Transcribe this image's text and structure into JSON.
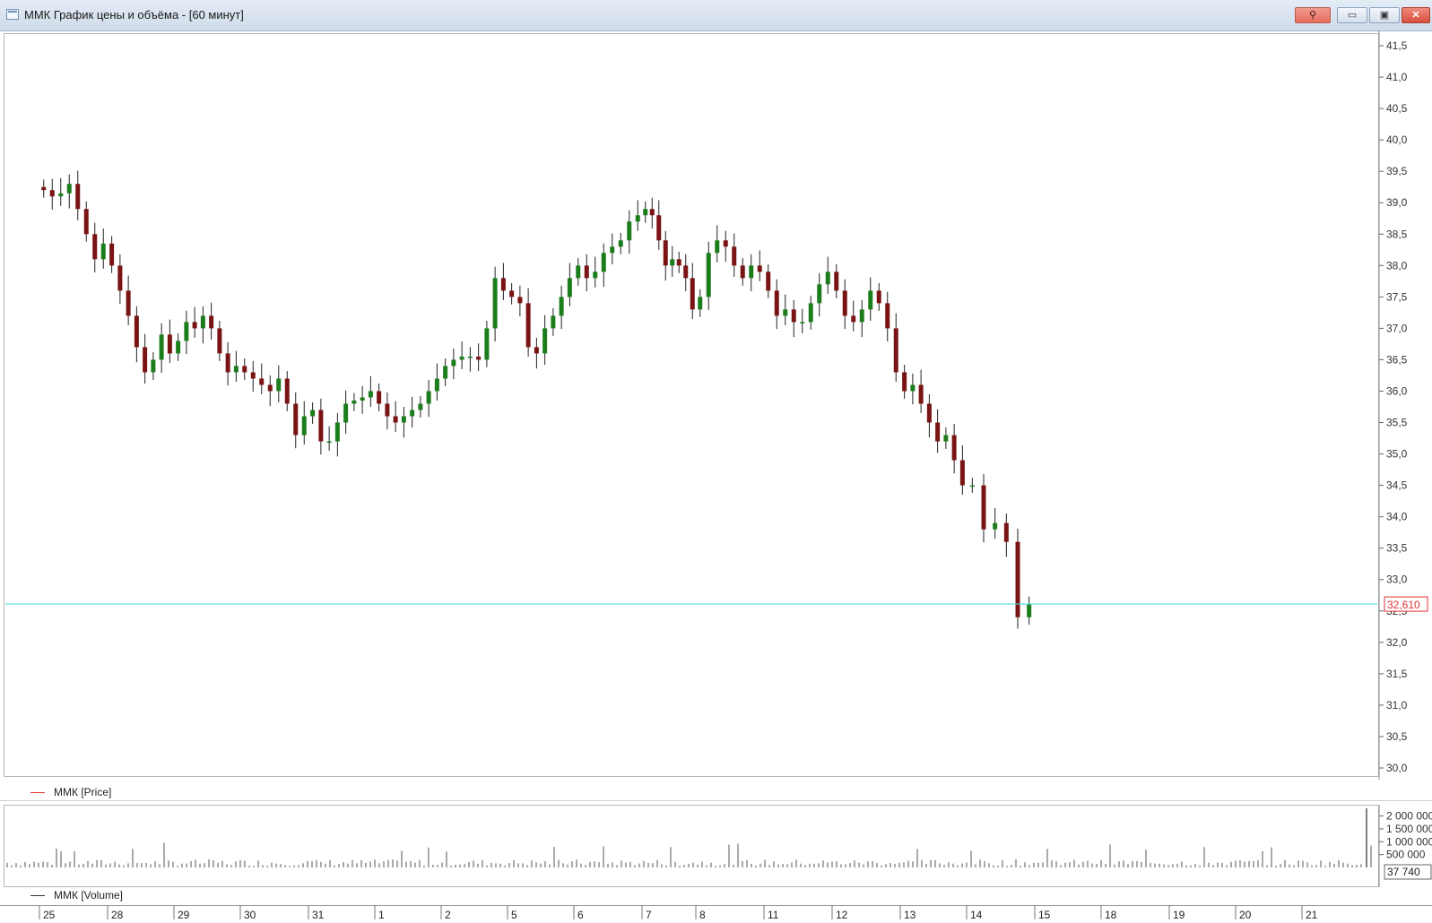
{
  "window": {
    "title": "ММК График цены и объёма - [60 минут]",
    "buttons": [
      {
        "name": "link-button",
        "icon": "link-icon",
        "glyph": "⚲"
      },
      {
        "name": "minimize-button",
        "icon": "minimize-icon",
        "glyph": "▭"
      },
      {
        "name": "maximize-button",
        "icon": "maximize-icon",
        "glyph": "▣"
      },
      {
        "name": "close-button",
        "icon": "close-icon",
        "glyph": "✕"
      }
    ]
  },
  "colors": {
    "bull": "#1b7d1b",
    "bear": "#7a1414",
    "wick": "#222222",
    "level_line": "#49dede",
    "price_label": "#e03030",
    "legend_price": "#e03030",
    "legend_volume": "#333333",
    "volume_bar": "#555555"
  },
  "price_panel": {
    "legend": "ММК [Price]",
    "current_price_label": "32,610"
  },
  "volume_panel": {
    "legend": "ММК [Volume]",
    "current_volume_label": "37 740"
  },
  "chart_data": [
    {
      "type": "candlestick",
      "name": "ММК [Price]",
      "interval": "60 минут",
      "ylim": [
        30.0,
        41.5
      ],
      "y_ticks": [
        "41,5",
        "41,0",
        "40,5",
        "40,0",
        "39,5",
        "39,0",
        "38,5",
        "38,0",
        "37,5",
        "37,0",
        "36,5",
        "36,0",
        "35,5",
        "35,0",
        "34,5",
        "34,0",
        "33,5",
        "33,0",
        "32,5",
        "32,0",
        "31,5",
        "31,0",
        "30,5",
        "30,0"
      ],
      "x_ticks": [
        "25",
        "28",
        "29",
        "30",
        "31",
        "1",
        "2",
        "5",
        "6",
        "7",
        "8",
        "11",
        "12",
        "13",
        "14",
        "15",
        "18",
        "19",
        "20",
        "21"
      ],
      "current_level": 32.61,
      "close_path": [
        [
          "25",
          39.2
        ],
        [
          "25",
          39.1
        ],
        [
          "25",
          39.15
        ],
        [
          "25",
          39.3
        ],
        [
          "25",
          38.9
        ],
        [
          "25",
          38.5
        ],
        [
          "25",
          38.1
        ],
        [
          "25",
          38.35
        ],
        [
          "28",
          38.0
        ],
        [
          "28",
          37.6
        ],
        [
          "28",
          37.2
        ],
        [
          "28",
          36.7
        ],
        [
          "28",
          36.3
        ],
        [
          "28",
          36.5
        ],
        [
          "28",
          36.9
        ],
        [
          "28",
          36.6
        ],
        [
          "29",
          36.8
        ],
        [
          "29",
          37.1
        ],
        [
          "29",
          37.0
        ],
        [
          "29",
          37.2
        ],
        [
          "29",
          37.0
        ],
        [
          "29",
          36.6
        ],
        [
          "29",
          36.3
        ],
        [
          "29",
          36.4
        ],
        [
          "30",
          36.3
        ],
        [
          "30",
          36.2
        ],
        [
          "30",
          36.1
        ],
        [
          "30",
          36.0
        ],
        [
          "30",
          36.2
        ],
        [
          "30",
          35.8
        ],
        [
          "30",
          35.3
        ],
        [
          "30",
          35.6
        ],
        [
          "31",
          35.7
        ],
        [
          "31",
          35.2
        ],
        [
          "31",
          35.2
        ],
        [
          "31",
          35.5
        ],
        [
          "31",
          35.8
        ],
        [
          "31",
          35.85
        ],
        [
          "31",
          35.9
        ],
        [
          "31",
          36.0
        ],
        [
          "1",
          35.8
        ],
        [
          "1",
          35.6
        ],
        [
          "1",
          35.5
        ],
        [
          "1",
          35.6
        ],
        [
          "1",
          35.7
        ],
        [
          "1",
          35.8
        ],
        [
          "1",
          36.0
        ],
        [
          "1",
          36.2
        ],
        [
          "2",
          36.4
        ],
        [
          "2",
          36.5
        ],
        [
          "2",
          36.55
        ],
        [
          "2",
          36.55
        ],
        [
          "2",
          36.5
        ],
        [
          "2",
          37.0
        ],
        [
          "2",
          37.8
        ],
        [
          "2",
          37.6
        ],
        [
          "5",
          37.5
        ],
        [
          "5",
          37.4
        ],
        [
          "5",
          36.7
        ],
        [
          "5",
          36.6
        ],
        [
          "5",
          37.0
        ],
        [
          "5",
          37.2
        ],
        [
          "5",
          37.5
        ],
        [
          "5",
          37.8
        ],
        [
          "6",
          38.0
        ],
        [
          "6",
          37.8
        ],
        [
          "6",
          37.9
        ],
        [
          "6",
          38.2
        ],
        [
          "6",
          38.3
        ],
        [
          "6",
          38.4
        ],
        [
          "6",
          38.7
        ],
        [
          "6",
          38.8
        ],
        [
          "7",
          38.9
        ],
        [
          "7",
          38.8
        ],
        [
          "7",
          38.4
        ],
        [
          "7",
          38.0
        ],
        [
          "7",
          38.1
        ],
        [
          "7",
          38.0
        ],
        [
          "7",
          37.8
        ],
        [
          "7",
          37.3
        ],
        [
          "8",
          37.5
        ],
        [
          "8",
          38.2
        ],
        [
          "8",
          38.4
        ],
        [
          "8",
          38.3
        ],
        [
          "8",
          38.0
        ],
        [
          "8",
          37.8
        ],
        [
          "8",
          38.0
        ],
        [
          "8",
          37.9
        ],
        [
          "11",
          37.6
        ],
        [
          "11",
          37.2
        ],
        [
          "11",
          37.3
        ],
        [
          "11",
          37.1
        ],
        [
          "11",
          37.1
        ],
        [
          "11",
          37.4
        ],
        [
          "11",
          37.7
        ],
        [
          "11",
          37.9
        ],
        [
          "12",
          37.6
        ],
        [
          "12",
          37.2
        ],
        [
          "12",
          37.1
        ],
        [
          "12",
          37.3
        ],
        [
          "12",
          37.6
        ],
        [
          "12",
          37.4
        ],
        [
          "12",
          37.0
        ],
        [
          "12",
          36.3
        ],
        [
          "13",
          36.0
        ],
        [
          "13",
          36.1
        ],
        [
          "13",
          35.8
        ],
        [
          "13",
          35.5
        ],
        [
          "13",
          35.2
        ],
        [
          "13",
          35.3
        ],
        [
          "13",
          34.9
        ],
        [
          "13",
          34.5
        ],
        [
          "14",
          34.5
        ],
        [
          "14",
          33.8
        ],
        [
          "14",
          33.9
        ],
        [
          "14",
          33.6
        ],
        [
          "14",
          32.4
        ],
        [
          "14",
          32.61
        ]
      ]
    },
    {
      "type": "bar",
      "name": "ММК [Volume]",
      "y_ticks": [
        "2 000 000",
        "1 500 000",
        "1 000 000",
        "500 000"
      ],
      "ylim": [
        0,
        2300000
      ],
      "current_volume": 37740
    }
  ]
}
